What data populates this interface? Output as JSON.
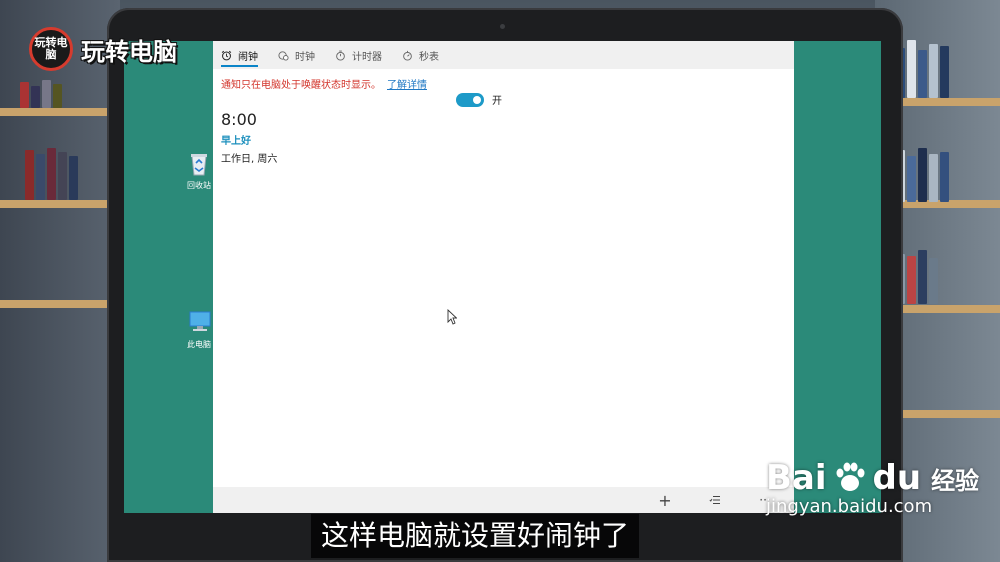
{
  "logo": {
    "badge": "玩转电脑",
    "text": "玩转电脑"
  },
  "desktop": {
    "icons": [
      {
        "label": "回收站"
      },
      {
        "label": "此电脑"
      }
    ],
    "background_color": "#2b8a79"
  },
  "app": {
    "tabs": [
      {
        "label": "闹钟",
        "icon": "alarm-clock-icon",
        "active": true
      },
      {
        "label": "时钟",
        "icon": "world-clock-icon",
        "active": false
      },
      {
        "label": "计时器",
        "icon": "timer-icon",
        "active": false
      },
      {
        "label": "秒表",
        "icon": "stopwatch-icon",
        "active": false
      }
    ],
    "notice": {
      "text": "通知只在电脑处于唤醒状态时显示。",
      "link": "了解详情"
    },
    "alarm": {
      "time": "8:00",
      "name": "早上好",
      "days": "工作日, 周六",
      "toggle_label": "开",
      "enabled": true
    },
    "bottom_bar": {
      "add_symbol": "+",
      "add_icon": "add-icon",
      "select_icon": "select-list-icon",
      "more_symbol": "···",
      "more_icon": "more-icon"
    }
  },
  "subtitle": "这样电脑就设置好闹钟了",
  "watermark": {
    "brand": "Bai",
    "brand2": "du",
    "cn": "经验",
    "url": "jingyan.baidu.com"
  },
  "colors": {
    "accent": "#1d9ac8",
    "notice_red": "#d2332a",
    "link_blue": "#1f78c4"
  }
}
